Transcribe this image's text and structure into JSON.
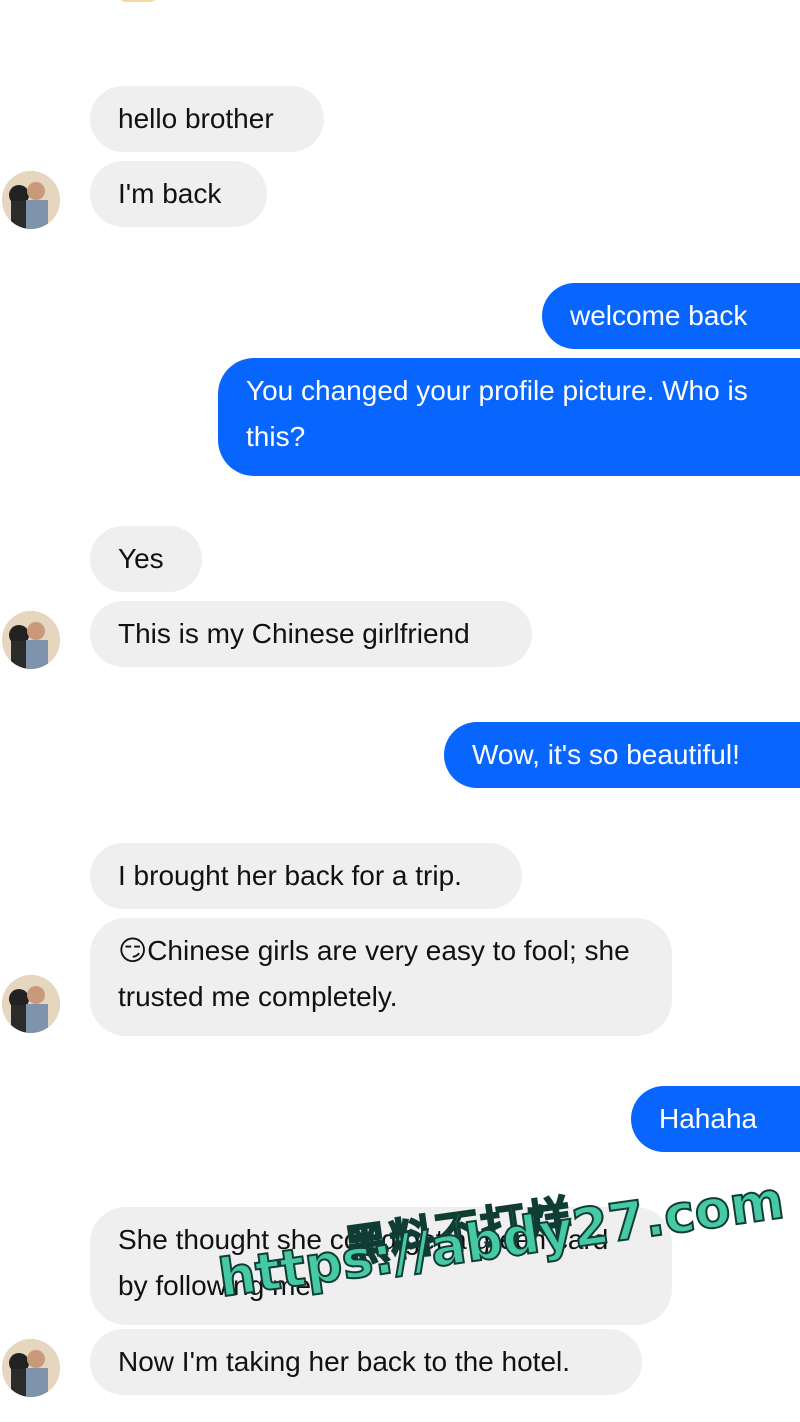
{
  "messages": [
    {
      "id": "m1",
      "side": "in",
      "text": "hello brother"
    },
    {
      "id": "m2",
      "side": "in",
      "text": "I'm back"
    },
    {
      "id": "m3",
      "side": "out",
      "text": "welcome back"
    },
    {
      "id": "m4",
      "side": "out",
      "text": "You changed your profile picture. Who is this?"
    },
    {
      "id": "m5",
      "side": "in",
      "text": "Yes"
    },
    {
      "id": "m6",
      "side": "in",
      "text": "This is my Chinese girlfriend"
    },
    {
      "id": "m7",
      "side": "out",
      "text": "Wow, it's so beautiful!"
    },
    {
      "id": "m8",
      "side": "in",
      "text": "I brought her back for a trip."
    },
    {
      "id": "m9",
      "side": "in",
      "text": "😏Chinese girls are very easy to fool; she trusted me completely."
    },
    {
      "id": "m10",
      "side": "out",
      "text": "Hahaha"
    },
    {
      "id": "m11",
      "side": "in",
      "text": "She thought she could get a green card by following me."
    },
    {
      "id": "m12",
      "side": "in",
      "text": "Now I'm taking her back to the hotel."
    }
  ],
  "watermark": {
    "line1": "黑料不打烊",
    "line2": "https://abdy27.com"
  },
  "colors": {
    "incoming_bubble": "#efefef",
    "outgoing_bubble": "#0866ff",
    "watermark": "#48c9a6"
  },
  "icons": {
    "avatar": "contact-avatar-icon"
  }
}
